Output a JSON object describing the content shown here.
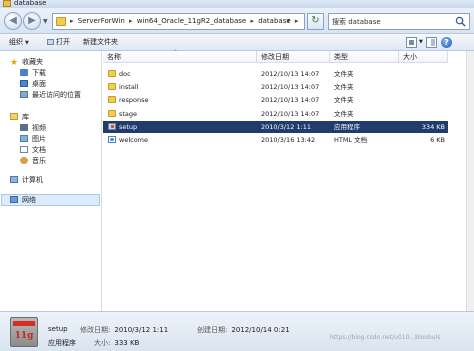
{
  "window": {
    "title": "database"
  },
  "address": {
    "crumbs": [
      "ServerForWin",
      "win64_Oracle_11gR2_database",
      "database"
    ]
  },
  "search": {
    "placeholder": "搜索 database"
  },
  "toolbar": {
    "organize": "组织",
    "open": "打开",
    "new_folder": "新建文件夹"
  },
  "sidebar": {
    "favorites": "收藏夹",
    "downloads": "下载",
    "desktop": "桌面",
    "recent": "最近访问的位置",
    "libraries": "库",
    "videos": "视频",
    "pictures": "图片",
    "documents": "文档",
    "music": "音乐",
    "computer": "计算机",
    "network": "网络"
  },
  "columns": {
    "name": "名称",
    "date": "修改日期",
    "type": "类型",
    "size": "大小"
  },
  "files": [
    {
      "name": "doc",
      "date": "2012/10/13 14:07",
      "type": "文件夹",
      "size": "",
      "icon": "folder-icon"
    },
    {
      "name": "install",
      "date": "2012/10/13 14:07",
      "type": "文件夹",
      "size": "",
      "icon": "folder-icon"
    },
    {
      "name": "response",
      "date": "2012/10/13 14:07",
      "type": "文件夹",
      "size": "",
      "icon": "folder-icon"
    },
    {
      "name": "stage",
      "date": "2012/10/13 14:07",
      "type": "文件夹",
      "size": "",
      "icon": "folder-icon"
    },
    {
      "name": "setup",
      "date": "2010/3/12 1:11",
      "type": "应用程序",
      "size": "334 KB",
      "icon": "exe-icon",
      "selected": true
    },
    {
      "name": "welcome",
      "date": "2010/3/16 13:42",
      "type": "HTML 文档",
      "size": "6 KB",
      "icon": "html-file-icon"
    }
  ],
  "details": {
    "name": "setup",
    "modified_label": "修改日期:",
    "modified": "2010/3/12 1:11",
    "created_label": "创建日期:",
    "created": "2012/10/14 0:21",
    "type": "应用程序",
    "size_label": "大小:",
    "size": "333 KB",
    "thumb_text": "11g"
  },
  "watermark": "https://blog.csdn.net/u010...bloobuls"
}
